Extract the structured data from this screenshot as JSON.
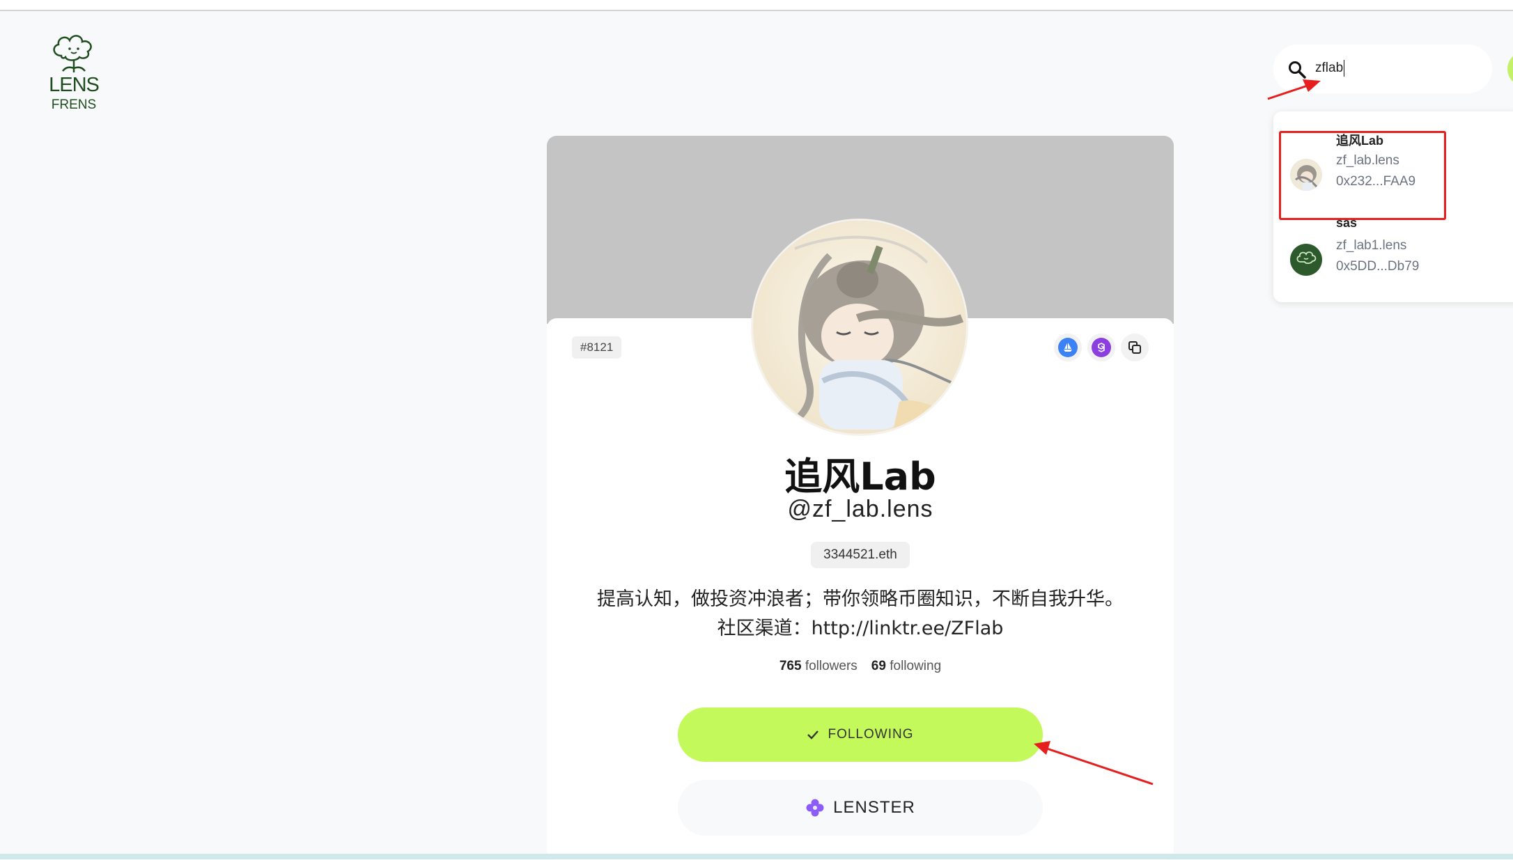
{
  "logo": {
    "line1": "LENS",
    "line2": "FRENS"
  },
  "search": {
    "value": "zflab",
    "icon": "search-icon"
  },
  "results": [
    {
      "name": "追风Lab",
      "handle": "zf_lab.lens",
      "address": "0x232...FAA9"
    },
    {
      "name": "sas",
      "handle": "zf_lab1.lens",
      "address": "0x5DD...Db79"
    }
  ],
  "profile": {
    "token_id": "#8121",
    "display_name": "追风Lab",
    "handle": "@zf_lab.lens",
    "ens": "3344521.eth",
    "bio_line1": "提高认知，做投资冲浪者；带你领略币圈知识，不断自我升华。",
    "bio_line2": "社区渠道：http://linktr.ee/ZFlab",
    "followers_count": "765",
    "followers_label": "followers",
    "following_count": "69",
    "following_label": "following",
    "actions": [
      "opensea-icon",
      "polygon-icon",
      "copy-icon"
    ]
  },
  "buttons": {
    "following": "FOLLOWING",
    "lenster": "LENSTER"
  },
  "colors": {
    "accent": "#c3f95b",
    "annotation": "#e61e1e",
    "cover": "#c4c4c4",
    "logo": "#1f4d1f"
  }
}
